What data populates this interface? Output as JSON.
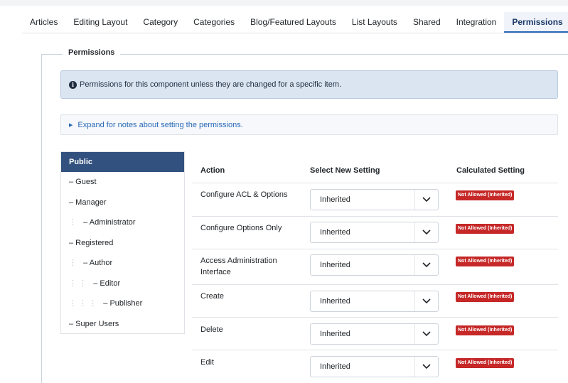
{
  "tabs": [
    {
      "label": "Articles",
      "active": false
    },
    {
      "label": "Editing Layout",
      "active": false
    },
    {
      "label": "Category",
      "active": false
    },
    {
      "label": "Categories",
      "active": false
    },
    {
      "label": "Blog/Featured Layouts",
      "active": false
    },
    {
      "label": "List Layouts",
      "active": false
    },
    {
      "label": "Shared",
      "active": false
    },
    {
      "label": "Integration",
      "active": false
    },
    {
      "label": "Permissions",
      "active": true
    }
  ],
  "fieldset": {
    "legend": "Permissions"
  },
  "alert": {
    "icon": "info-circle-icon",
    "text": "Permissions for this component unless they are changed for a specific item."
  },
  "expander": {
    "icon": "triangle-right-icon",
    "text": "Expand for notes about setting the permissions."
  },
  "groups": {
    "selected": "Public",
    "items": [
      {
        "dots": "",
        "label": "– Guest"
      },
      {
        "dots": "",
        "label": "– Manager"
      },
      {
        "dots": "⋮",
        "label": "– Administrator"
      },
      {
        "dots": "",
        "label": "– Registered"
      },
      {
        "dots": "⋮",
        "label": "– Author"
      },
      {
        "dots": "⋮ ⋮",
        "label": "– Editor"
      },
      {
        "dots": "⋮ ⋮ ⋮",
        "label": "– Publisher"
      },
      {
        "dots": "",
        "label": "– Super Users"
      }
    ]
  },
  "table": {
    "headers": {
      "action": "Action",
      "select": "Select New Setting",
      "calculated": "Calculated Setting"
    },
    "rows": [
      {
        "action": "Configure ACL & Options",
        "setting": "Inherited",
        "calculated": "Not Allowed (Inherited)"
      },
      {
        "action": "Configure Options Only",
        "setting": "Inherited",
        "calculated": "Not Allowed (Inherited)"
      },
      {
        "action": "Access Administration Interface",
        "setting": "Inherited",
        "calculated": "Not Allowed (Inherited)"
      },
      {
        "action": "Create",
        "setting": "Inherited",
        "calculated": "Not Allowed (Inherited)"
      },
      {
        "action": "Delete",
        "setting": "Inherited",
        "calculated": "Not Allowed (Inherited)"
      },
      {
        "action": "Edit",
        "setting": "Inherited",
        "calculated": "Not Allowed (Inherited)"
      }
    ]
  },
  "colors": {
    "accent": "#2a69b8",
    "group_header": "#33517e",
    "danger_badge": "#c52827",
    "alert_bg": "#dbe5f1"
  }
}
